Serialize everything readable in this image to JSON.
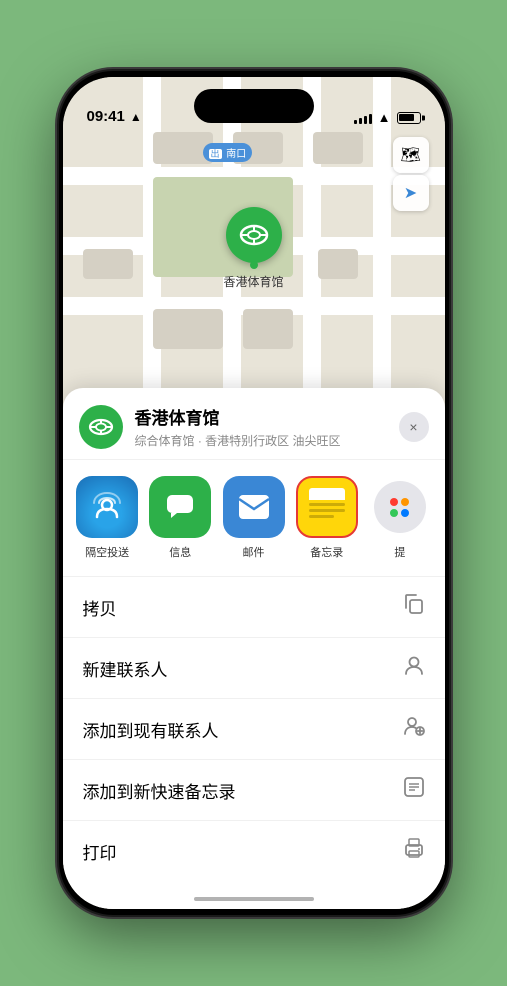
{
  "status_bar": {
    "time": "09:41",
    "location_arrow": "▶",
    "signal_bars": [
      3,
      5,
      7,
      9,
      11
    ],
    "wifi": "wifi",
    "battery_level": 80
  },
  "map": {
    "label_text": "南口",
    "label_prefix": "出",
    "venue_name_pin": "香港体育馆",
    "map_type_icon": "🗺",
    "location_icon": "➤"
  },
  "bottom_sheet": {
    "venue_name": "香港体育馆",
    "venue_desc": "综合体育馆 · 香港特别行政区 油尖旺区",
    "close_label": "×",
    "share_items": [
      {
        "id": "airdrop",
        "label": "隔空投送",
        "bg": "airdrop"
      },
      {
        "id": "messages",
        "label": "信息",
        "bg": "green"
      },
      {
        "id": "mail",
        "label": "邮件",
        "bg": "blue"
      },
      {
        "id": "notes",
        "label": "备忘录",
        "bg": "yellow"
      },
      {
        "id": "more",
        "label": "提",
        "bg": "dots"
      }
    ],
    "action_items": [
      {
        "id": "copy",
        "label": "拷贝",
        "icon": "copy"
      },
      {
        "id": "new-contact",
        "label": "新建联系人",
        "icon": "person"
      },
      {
        "id": "add-contact",
        "label": "添加到现有联系人",
        "icon": "person-add"
      },
      {
        "id": "quick-note",
        "label": "添加到新快速备忘录",
        "icon": "note"
      },
      {
        "id": "print",
        "label": "打印",
        "icon": "print"
      }
    ]
  },
  "more_dots_colors": [
    "#ff3b30",
    "#ff9500",
    "#34c759",
    "#007aff",
    "#af52de"
  ]
}
